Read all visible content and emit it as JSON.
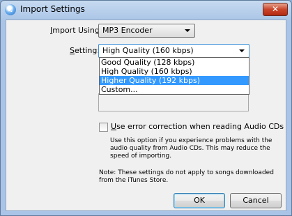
{
  "window": {
    "title": "Import Settings",
    "close_label": "✕"
  },
  "form": {
    "import_using_label": "Import Using:",
    "import_using_value": "MP3 Encoder",
    "setting_label": "Setting:",
    "setting_value": "High Quality (160 kbps)",
    "setting_options": [
      "Good Quality (128 kbps)",
      "High Quality (160 kbps)",
      "Higher Quality (192 kbps)",
      "Custom..."
    ],
    "highlighted_option": "Higher Quality (192 kbps)",
    "error_correction_label": "Use error correction when reading Audio CDs",
    "error_correction_checked": false,
    "error_correction_help": "Use this option if you experience problems with the audio quality from Audio CDs.  This may reduce the speed of importing.",
    "note": "Note: These settings do not apply to songs downloaded from the iTunes Store."
  },
  "buttons": {
    "ok_label": "OK",
    "cancel_label": "Cancel"
  },
  "colors": {
    "highlight": "#3399ff",
    "frame": "#a9c4e6"
  }
}
